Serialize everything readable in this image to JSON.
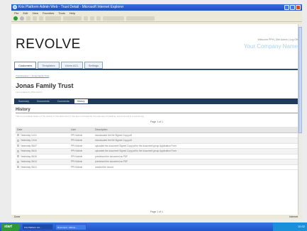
{
  "browser": {
    "title": "Kris Platform Admin Web - Trust Detail - Microsoft Internet Explorer",
    "menu": [
      "File",
      "Edit",
      "View",
      "Favorites",
      "Tools",
      "Help"
    ]
  },
  "header": {
    "logo": "REVOLVE",
    "welcome": "Welcome PPH | Site Admin | Log Off",
    "company": "Your Company Name"
  },
  "topnav": [
    "Customers",
    "Templates",
    "Users ACL",
    "Settings"
  ],
  "breadcrumb": "Trust Explorer > Jonas Family Trust",
  "page": {
    "title": "Jonas Family Trust",
    "subtitle": "Last updated by PPH Admin"
  },
  "subnav": [
    "Summary",
    "Documents",
    "Comments",
    "History"
  ],
  "history": {
    "title": "History",
    "description": "This is a complete history of the activity in this document. It has been recorded for the purposes of tracking, and is stored in a secure log.",
    "pager": "Page 1 of 1",
    "columns": [
      "Date",
      "User",
      "Description"
    ],
    "rows": [
      {
        "date": "Yesterday 14:01",
        "user": "PPH Admin",
        "desc": "downloaded the file Signed Copy.pdf"
      },
      {
        "date": "Yesterday 13:44",
        "user": "PPH Admin",
        "desc": "downloaded the file Signed Copy.pdf"
      },
      {
        "date": "Yesterday 08:57",
        "user": "PPH Admin",
        "desc": "uploaded the document Signed Copy.pdf to the document group Application Form"
      },
      {
        "date": "Yesterday 08:41",
        "user": "PPH Admin",
        "desc": "uploaded the document Signed Copy.pdf to the document group Application Form"
      },
      {
        "date": "Yesterday 08:26",
        "user": "PPH Admin",
        "desc": "previewed the document as PDF"
      },
      {
        "date": "Yesterday 08:24",
        "user": "PPH Admin",
        "desc": "previewed the document as PDF"
      },
      {
        "date": "Yesterday 08:21",
        "user": "PPH Admin",
        "desc": "created the record"
      }
    ]
  },
  "status": {
    "left": "Done",
    "right": "Internet"
  },
  "taskbar": {
    "start": "start",
    "items": [
      "Kris Platform Ad...",
      "Document - Micros..."
    ],
    "clock": "10:32"
  }
}
